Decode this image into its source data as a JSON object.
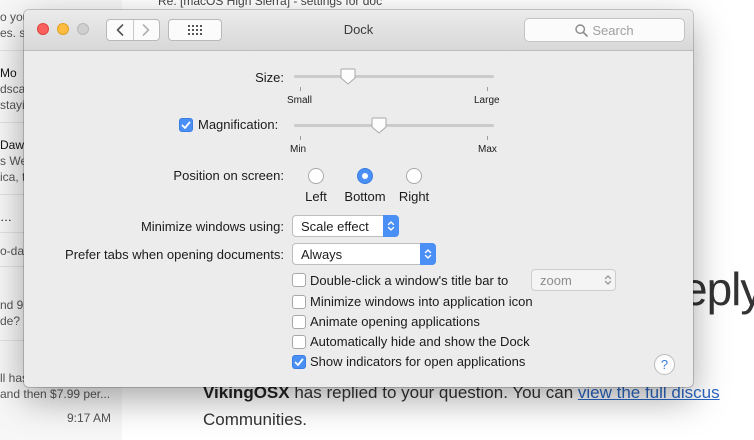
{
  "background": {
    "top_subject": "Re: [macOS High Sierra] - settings for doc",
    "mail_fragments": [
      "o you",
      "es. se",
      "Mo",
      "dsca",
      "stayi",
      "Daws",
      "s We",
      "ica, t",
      "…",
      "o-da",
      "nd 9",
      "de? S",
      "ll has",
      "and then $7.99 per..."
    ],
    "mail_time": "9:17 AM",
    "big_text": "eply",
    "body_bold": "VikingOSX",
    "body_text": " has replied to your question. You can ",
    "body_link": "view the full discus",
    "body_line2": "Communities."
  },
  "window": {
    "title": "Dock",
    "search_placeholder": "Search"
  },
  "size": {
    "label": "Size:",
    "min_label": "Small",
    "max_label": "Large",
    "value_fraction": 0.25
  },
  "magnification": {
    "label": "Magnification:",
    "checked": true,
    "min_label": "Min",
    "max_label": "Max",
    "value_fraction": 0.42
  },
  "position": {
    "label": "Position on screen:",
    "options": [
      "Left",
      "Bottom",
      "Right"
    ],
    "selected": "Bottom"
  },
  "minimize": {
    "label": "Minimize windows using:",
    "value": "Scale effect"
  },
  "prefer_tabs": {
    "label": "Prefer tabs when opening documents:",
    "value": "Always"
  },
  "checkboxes": [
    {
      "label": "Double-click a window's title bar to",
      "checked": false
    },
    {
      "label": "Minimize windows into application icon",
      "checked": false
    },
    {
      "label": "Animate opening applications",
      "checked": false
    },
    {
      "label": "Automatically hide and show the Dock",
      "checked": false
    },
    {
      "label": "Show indicators for open applications",
      "checked": true
    }
  ],
  "double_click_action": {
    "value": "zoom"
  },
  "help_label": "?",
  "colors": {
    "accent": "#4a8ff5",
    "close": "#fc605c",
    "minimize": "#fdbc40"
  }
}
